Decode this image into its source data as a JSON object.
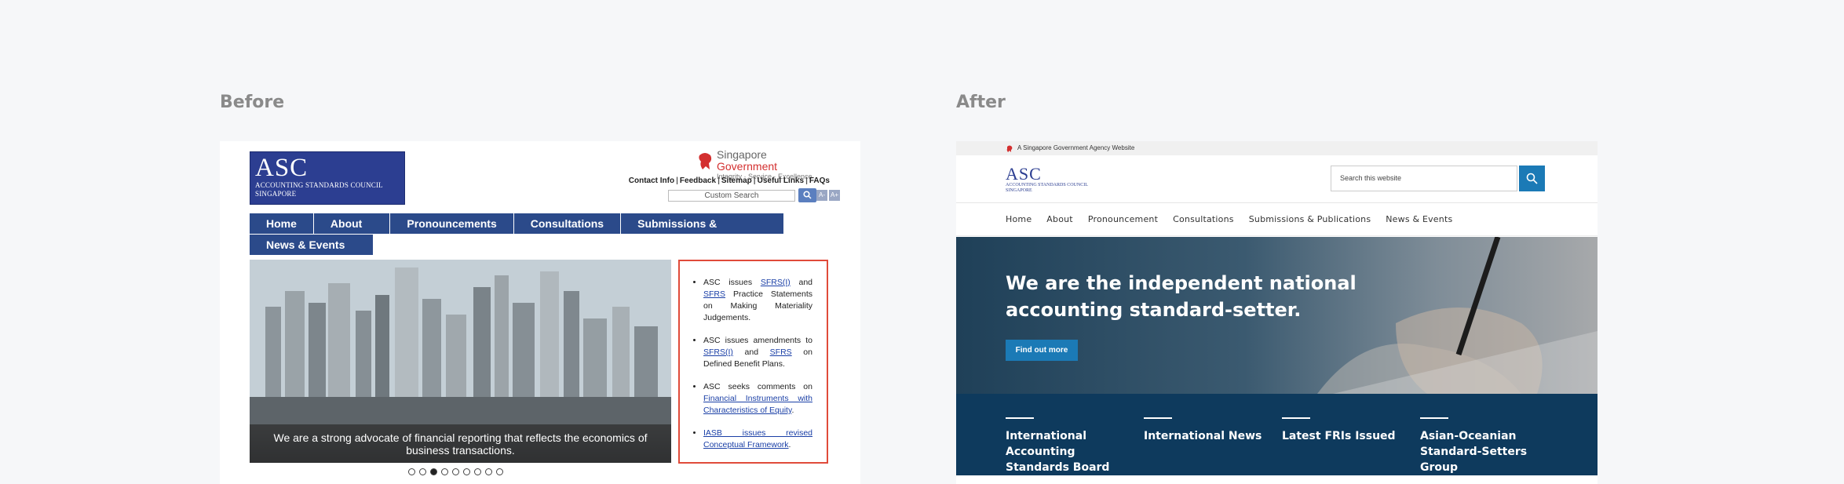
{
  "labels": {
    "before": "Before",
    "after": "After"
  },
  "before": {
    "logo": {
      "title": "ASC",
      "line1": "ACCOUNTING STANDARDS COUNCIL",
      "line2": "SINGAPORE"
    },
    "gov": {
      "word1": "Singapore",
      "word2": "Government",
      "tagline": "Integrity · Service · Excellence"
    },
    "top_links": [
      "Contact Info",
      "Feedback",
      "Sitemap",
      "Useful Links",
      "FAQs"
    ],
    "search_placeholder": "Custom Search",
    "font_buttons": [
      "A-",
      "A+"
    ],
    "nav_row1": [
      "Home",
      "About Us",
      "Pronouncements",
      "Consultations",
      "Submissions & Publications"
    ],
    "nav_row2": [
      "News & Events"
    ],
    "hero_caption": "We are a strong advocate of financial reporting that reflects the economics of business transactions.",
    "slides_count": 9,
    "active_slide": 3,
    "news": [
      {
        "pre": "ASC issues ",
        "link1": "SFRS(I)",
        "mid": " and ",
        "link2": "SFRS",
        "post": " Practice Statements on Making Materiality Judgements."
      },
      {
        "pre": "ASC issues amendments to ",
        "link1": "SFRS(I)",
        "mid": " and ",
        "link2": "SFRS",
        "post": " on Defined Benefit Plans."
      },
      {
        "pre": "ASC seeks comments on ",
        "link1": "Financial Instruments with Characteristics of Equity",
        "mid": "",
        "link2": "",
        "post": "."
      },
      {
        "pre": "",
        "link1": "IASB issues revised Conceptual Framework",
        "mid": "",
        "link2": "",
        "post": "."
      }
    ]
  },
  "after": {
    "masthead": "A Singapore Government Agency Website",
    "logo": {
      "title": "ASC",
      "line1": "ACCOUNTING STANDARDS COUNCIL",
      "line2": "SINGAPORE"
    },
    "search_placeholder": "Search this website",
    "nav": [
      "Home",
      "About",
      "Pronouncement",
      "Consultations",
      "Submissions & Publications",
      "News & Events"
    ],
    "hero_title": "We are the independent national accounting standard-setter.",
    "cta": "Find out more",
    "tiles": [
      "International Accounting Standards Board",
      "International News",
      "Latest FRIs Issued",
      "Asian-Oceanian Standard-Setters Group"
    ]
  },
  "colors": {
    "old_nav": "#2b4a8a",
    "old_logo": "#2c3e91",
    "news_border": "#e04b3a",
    "new_accent": "#1b7ab6",
    "new_band": "#0e3a5d"
  }
}
